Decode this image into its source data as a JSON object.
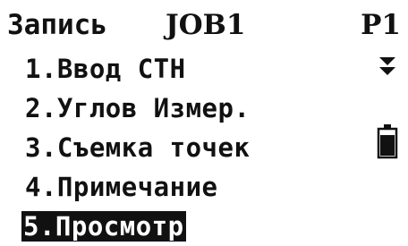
{
  "header": {
    "title": "Запись",
    "job": "JOB1",
    "page": "P1"
  },
  "menu": {
    "items": [
      {
        "label": "1.Ввод СТН"
      },
      {
        "label": "2.Углов Измер."
      },
      {
        "label": "3.Съемка точек"
      },
      {
        "label": "4.Примечание"
      },
      {
        "label": "5.Просмотр",
        "selected": true
      }
    ]
  },
  "icons": {
    "scroll": "double-chevron-down-icon",
    "battery": "battery-icon"
  },
  "colors": {
    "text": "#111111",
    "background": "#ffffff",
    "highlight": "#111111"
  }
}
